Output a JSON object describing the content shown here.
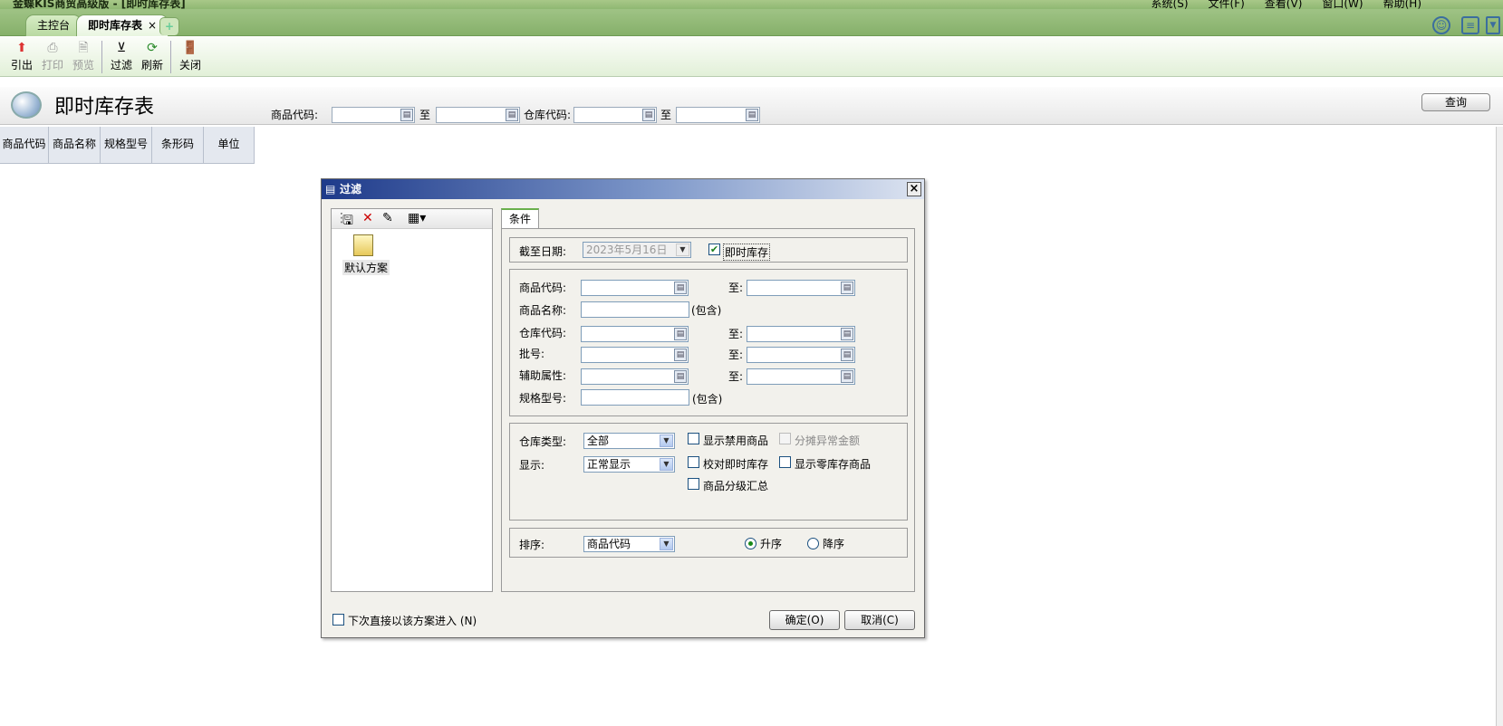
{
  "titlebar": {
    "title": "金蝶KIS商贸高级版 - [即时库存表]",
    "menu": [
      "系统(S)",
      "文件(F)",
      "查看(V)",
      "窗口(W)",
      "帮助(H)"
    ]
  },
  "tabs": {
    "home": "主控台",
    "active": "即时库存表",
    "close": "×",
    "add": "+"
  },
  "toolbar": {
    "export": "引出",
    "print": "打印",
    "preview": "预览",
    "filter": "过滤",
    "refresh": "刷新",
    "close": "关闭"
  },
  "header": {
    "title": "即时库存表",
    "item_code_label": "商品代码:",
    "to1": "至",
    "warehouse_code_label": "仓库代码:",
    "to2": "至",
    "query_button": "查询"
  },
  "columns": [
    "商品代码",
    "商品名称",
    "规格型号",
    "条形码",
    "单位"
  ],
  "dialog": {
    "title": "过滤",
    "scheme_label": "默认方案",
    "tab_label": "条件",
    "as_of_label": "截至日期:",
    "as_of_value": "2023年5月16日",
    "realtime_label": "即时库存",
    "item_code_label": "商品代码:",
    "item_name_label": "商品名称:",
    "contains1": "(包含)",
    "warehouse_code_label": "仓库代码:",
    "batch_label": "批号:",
    "aux_attr_label": "辅助属性:",
    "spec_label": "规格型号:",
    "contains2": "(包含)",
    "to": "至:",
    "warehouse_type_label": "仓库类型:",
    "warehouse_type_value": "全部",
    "display_label": "显示:",
    "display_value": "正常显示",
    "show_disabled": "显示禁用商品",
    "allocate_abnormal": "分摊异常金额",
    "check_realtime": "校对即时库存",
    "show_zero": "显示零库存商品",
    "category_summary": "商品分级汇总",
    "sort_label": "排序:",
    "sort_value": "商品代码",
    "asc": "升序",
    "desc": "降序",
    "next_time": "下次直接以该方案进入 (N)",
    "ok": "确定(O)",
    "cancel": "取消(C)"
  }
}
